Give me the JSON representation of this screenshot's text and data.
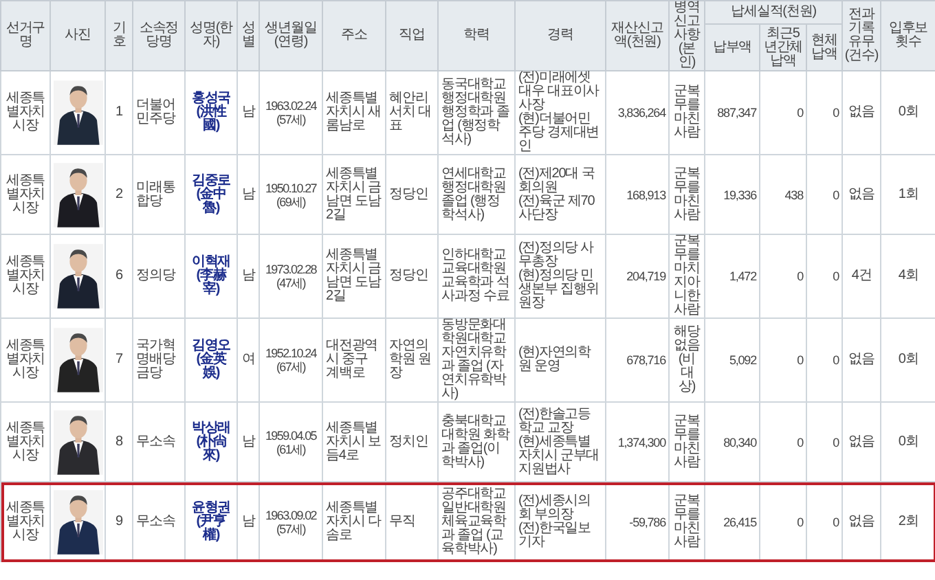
{
  "table": {
    "columns": [
      {
        "label": "선거구명"
      },
      {
        "label": "사진"
      },
      {
        "label": "기호"
      },
      {
        "label": "소속정당명"
      },
      {
        "label": "성명(한자)"
      },
      {
        "label": "성별"
      },
      {
        "label": "생년월일(연령)"
      },
      {
        "label": "주소"
      },
      {
        "label": "직업"
      },
      {
        "label": "학력"
      },
      {
        "label": "경력"
      },
      {
        "label": "재산신고액(천원)"
      },
      {
        "label": "병역신고사항(본인)"
      },
      {
        "label": "납세실적(천원)",
        "children": [
          {
            "label": "납부액"
          },
          {
            "label": "최근5년간체납액"
          },
          {
            "label": "현체납액"
          }
        ]
      },
      {
        "label": "전과기록유무(건수)"
      },
      {
        "label": "입후보횟수"
      }
    ],
    "rows": [
      {
        "district": "세종특별자치시장",
        "number": "1",
        "party": "더불어민주당",
        "name": "홍성국",
        "hanja": "(洪性國)",
        "sex": "남",
        "birth": "1963.02.24",
        "age": "(57세)",
        "address": "세종특별자치시 새롬남로",
        "job": "혜안리서치 대표",
        "education": "동국대학교 행정대학원 행정학과 졸업 (행정학석사)",
        "career": [
          "(전)미래에셋대우 대표이사 사장",
          "(현)더불어민주당 경제대변인"
        ],
        "property": "3,836,264",
        "military": "군복무를마친사람",
        "tax_paid": "887,347",
        "arrears_5y": "0",
        "arrears_now": "0",
        "criminal": "없음",
        "runs": "0회",
        "highlighted": false
      },
      {
        "district": "세종특별자치시장",
        "number": "2",
        "party": "미래통합당",
        "name": "김중로",
        "hanja": "(金中魯)",
        "sex": "남",
        "birth": "1950.10.27",
        "age": "(69세)",
        "address": "세종특별자치시 금남면 도남2길",
        "job": "정당인",
        "education": "연세대학교 행정대학원 졸업 (행정학석사)",
        "career": [
          "(전)제20대 국회의원",
          "(전)육군 제70사단장"
        ],
        "property": "168,913",
        "military": "군복무를마친사람",
        "tax_paid": "19,336",
        "arrears_5y": "438",
        "arrears_now": "0",
        "criminal": "없음",
        "runs": "1회",
        "highlighted": false
      },
      {
        "district": "세종특별자치시장",
        "number": "6",
        "party": "정의당",
        "name": "이혁재",
        "hanja": "(李赫宰)",
        "sex": "남",
        "birth": "1973.02.28",
        "age": "(47세)",
        "address": "세종특별자치시 금남면 도남2길",
        "job": "정당인",
        "education": "인하대학교 교육대학원 교육학과 석사과정 수료",
        "career": [
          "(전)정의당 사무총장",
          "(현)정의당 민생본부 집행위원장"
        ],
        "property": "204,719",
        "military": "군복무를마치지아니한사람",
        "tax_paid": "1,472",
        "arrears_5y": "0",
        "arrears_now": "0",
        "criminal": "4건",
        "runs": "4회",
        "highlighted": false
      },
      {
        "district": "세종특별자치시장",
        "number": "7",
        "party": "국가혁명배당금당",
        "name": "김영오",
        "hanja": "(金英娛)",
        "sex": "여",
        "birth": "1952.10.24",
        "age": "(67세)",
        "address": "대전광역시 중구 계백로",
        "job": "자연의학원 원장",
        "education": "동방문화대학원대학교 자연치유학과 졸업 (자연치유학박사)",
        "career": [
          "(현)자연의학원 운영"
        ],
        "property": "678,716",
        "military": "해당없음(비대상)",
        "tax_paid": "5,092",
        "arrears_5y": "0",
        "arrears_now": "0",
        "criminal": "없음",
        "runs": "0회",
        "highlighted": false
      },
      {
        "district": "세종특별자치시장",
        "number": "8",
        "party": "무소속",
        "name": "박상래",
        "hanja": "(朴尙來)",
        "sex": "남",
        "birth": "1959.04.05",
        "age": "(61세)",
        "address": "세종특별자치시 보듬4로",
        "job": "정치인",
        "education": "충북대학교 대학원 화학과 졸업(이학박사)",
        "career": [
          "(전)한솔고등학교 교장",
          "(현)세종특별자치시 군부대 지원법사"
        ],
        "property": "1,374,300",
        "military": "군복무를마친사람",
        "tax_paid": "80,340",
        "arrears_5y": "0",
        "arrears_now": "0",
        "criminal": "없음",
        "runs": "0회",
        "highlighted": false
      },
      {
        "district": "세종특별자치시장",
        "number": "9",
        "party": "무소속",
        "name": "윤형권",
        "hanja": "(尹亨權)",
        "sex": "남",
        "birth": "1963.09.02",
        "age": "(57세)",
        "address": "세종특별자치시 다솜로",
        "job": "무직",
        "education": "공주대학교 일반대학원 체육교육학과 졸업 (교육학박사)",
        "career": [
          "(전)세종시의회 부의장",
          "(전)한국일보기자"
        ],
        "property": "-59,786",
        "military": "군복무를마친사람",
        "tax_paid": "26,415",
        "arrears_5y": "0",
        "arrears_now": "0",
        "criminal": "없음",
        "runs": "2회",
        "highlighted": true
      }
    ]
  }
}
